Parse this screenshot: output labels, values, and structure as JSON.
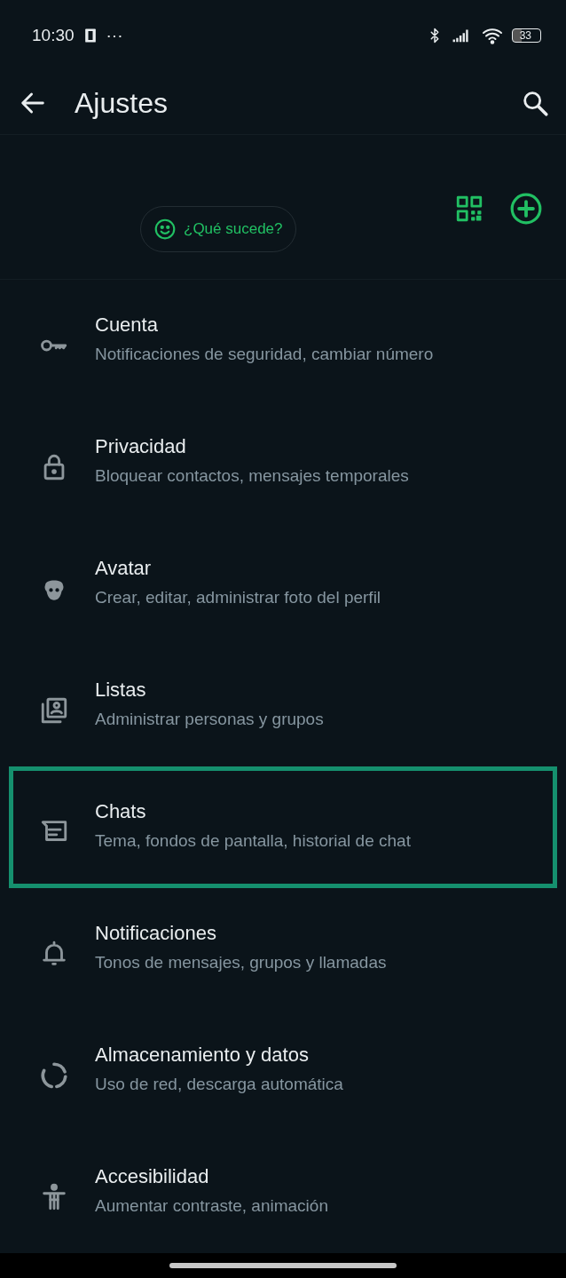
{
  "status_bar": {
    "time": "10:30",
    "more": "···",
    "battery": "33"
  },
  "app_bar": {
    "title": "Ajustes"
  },
  "profile": {
    "status_placeholder": "¿Qué sucede?"
  },
  "settings": [
    {
      "kind": "key",
      "title": "Cuenta",
      "subtitle": "Notificaciones de seguridad, cambiar número",
      "selected": false
    },
    {
      "kind": "lock",
      "title": "Privacidad",
      "subtitle": "Bloquear contactos, mensajes temporales",
      "selected": false
    },
    {
      "kind": "avatar",
      "title": "Avatar",
      "subtitle": "Crear, editar, administrar foto del perfil",
      "selected": false
    },
    {
      "kind": "lists",
      "title": "Listas",
      "subtitle": "Administrar personas y grupos",
      "selected": false
    },
    {
      "kind": "chats",
      "title": "Chats",
      "subtitle": "Tema, fondos de pantalla, historial de chat",
      "selected": true
    },
    {
      "kind": "bell",
      "title": "Notificaciones",
      "subtitle": "Tonos de mensajes, grupos y llamadas",
      "selected": false
    },
    {
      "kind": "storage",
      "title": "Almacenamiento y datos",
      "subtitle": "Uso de red, descarga automática",
      "selected": false
    },
    {
      "kind": "accessibility",
      "title": "Accesibilidad",
      "subtitle": "Aumentar contraste, animación",
      "selected": false
    }
  ]
}
